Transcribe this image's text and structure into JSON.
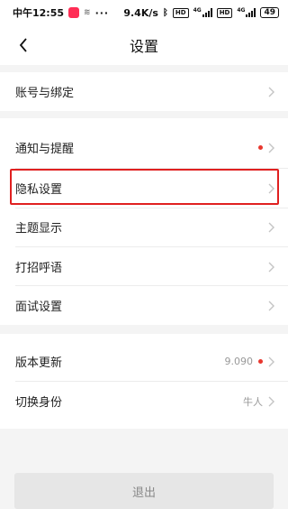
{
  "status_bar": {
    "time": "中午12:55",
    "dots": "···",
    "speed": "9.4K/s",
    "net1": "4G",
    "net2": "4G",
    "hd1": "HD",
    "hd2": "HD",
    "battery": "49"
  },
  "nav": {
    "title": "设置"
  },
  "settings": [
    {
      "label": "账号与绑定"
    },
    {
      "label": "通知与提醒",
      "dot": true
    },
    {
      "label": "隐私设置",
      "highlighted": true
    },
    {
      "label": "主题显示"
    },
    {
      "label": "打招呼语"
    },
    {
      "label": "面试设置"
    },
    {
      "label": "版本更新",
      "value": "9.090",
      "dot": true
    },
    {
      "label": "切换身份",
      "value": "牛人"
    }
  ],
  "logout_label": "退出",
  "colors": {
    "accent_red": "#e8372e",
    "highlight_border": "#e02020"
  }
}
